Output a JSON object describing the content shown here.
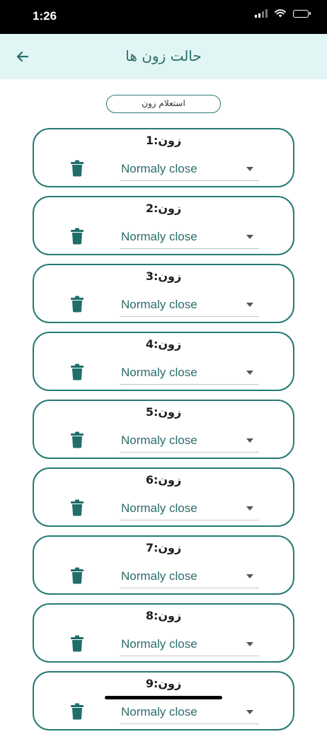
{
  "status_bar": {
    "time": "1:26"
  },
  "header": {
    "title": "حالت زون ها"
  },
  "query_button": {
    "label": "استعلام زون"
  },
  "zones": [
    {
      "label": "زون:1",
      "mode": "Normaly close"
    },
    {
      "label": "زون:2",
      "mode": "Normaly close"
    },
    {
      "label": "زون:3",
      "mode": "Normaly close"
    },
    {
      "label": "زون:4",
      "mode": "Normaly close"
    },
    {
      "label": "زون:5",
      "mode": "Normaly close"
    },
    {
      "label": "زون:6",
      "mode": "Normaly close"
    },
    {
      "label": "زون:7",
      "mode": "Normaly close"
    },
    {
      "label": "زون:8",
      "mode": "Normaly close"
    },
    {
      "label": "زون:9",
      "mode": "Normaly close"
    }
  ],
  "icons": {
    "back": "arrow-left-icon",
    "delete": "trash-icon",
    "dropdown": "caret-down-icon"
  },
  "colors": {
    "accent": "#257a74",
    "header_bg": "#e0f5f4",
    "text_teal": "#2a6d6a"
  }
}
